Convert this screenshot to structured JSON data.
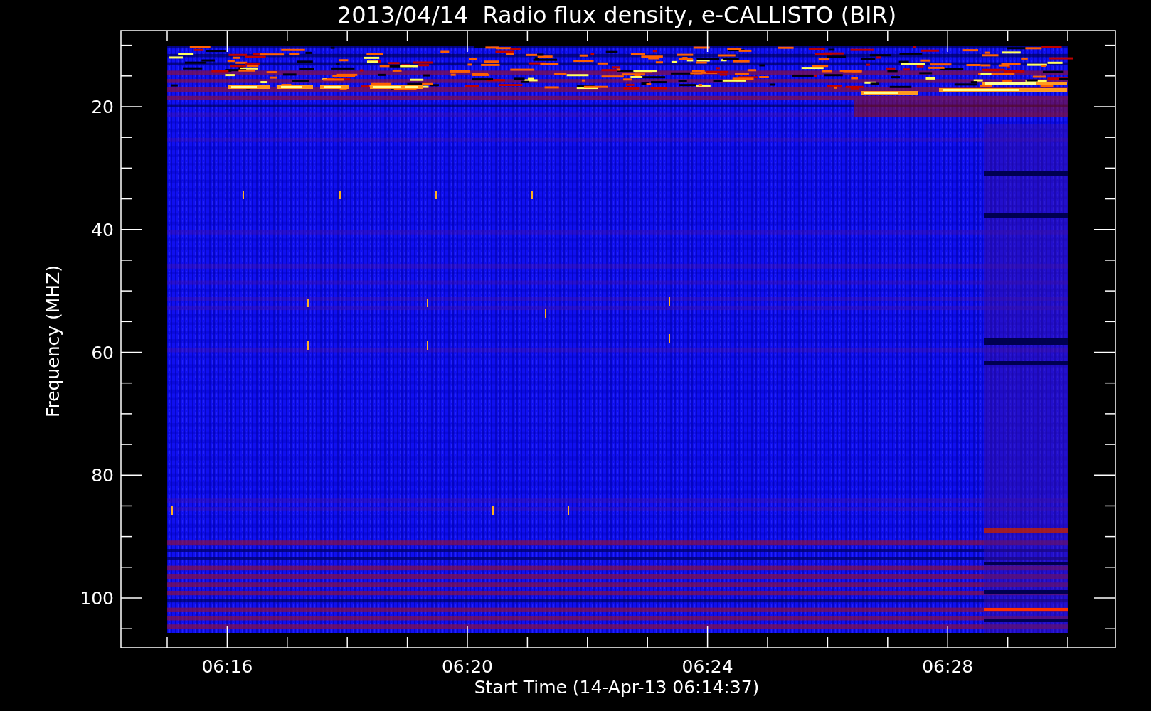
{
  "title": "2013/04/14  Radio flux density, e-CALLISTO (BIR)",
  "y_axis": {
    "label": "Frequency (MHZ)",
    "ticks": [
      "20",
      "40",
      "60",
      "80",
      "100"
    ]
  },
  "x_axis": {
    "label": "Start Time (14-Apr-13 06:14:37)",
    "ticks": [
      "06:16",
      "06:20",
      "06:24",
      "06:28"
    ]
  }
}
